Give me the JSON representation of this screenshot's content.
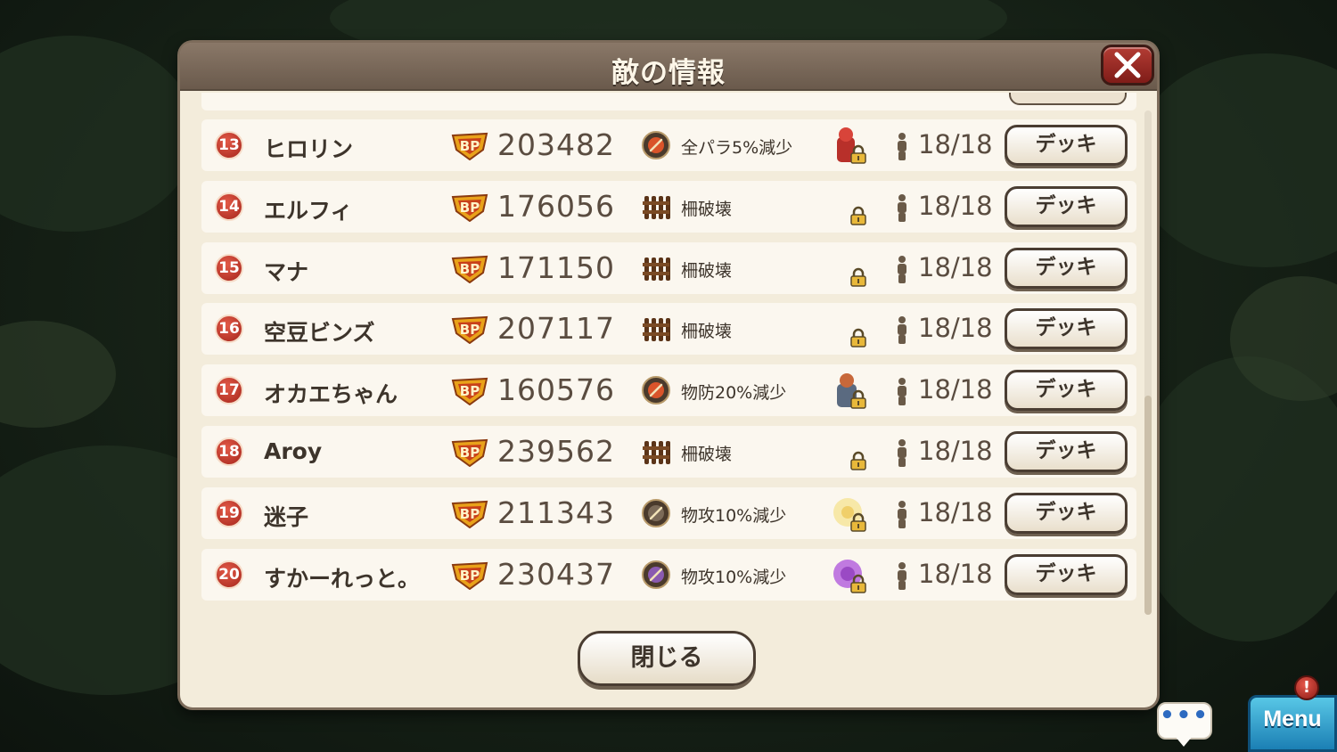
{
  "dialog": {
    "title": "敵の情報",
    "close_icon": "close-x-icon",
    "close_button_label": "閉じる"
  },
  "players": [
    {
      "rank": "13",
      "name": "ヒロリン",
      "bp": "203482",
      "skill_icon": "fire-shield-icon",
      "skill": "全パラ5%減少",
      "pet": "red-knight-pet-icon",
      "stamina": "18/18",
      "deck_label": "デッキ"
    },
    {
      "rank": "14",
      "name": "エルフィ",
      "bp": "176056",
      "skill_icon": "fence-icon",
      "skill": "柵破壊",
      "pet": "none",
      "stamina": "18/18",
      "deck_label": "デッキ"
    },
    {
      "rank": "15",
      "name": "マナ",
      "bp": "171150",
      "skill_icon": "fence-icon",
      "skill": "柵破壊",
      "pet": "none",
      "stamina": "18/18",
      "deck_label": "デッキ"
    },
    {
      "rank": "16",
      "name": "空豆ビンズ",
      "bp": "207117",
      "skill_icon": "fence-icon",
      "skill": "柵破壊",
      "pet": "none",
      "stamina": "18/18",
      "deck_label": "デッキ"
    },
    {
      "rank": "17",
      "name": "オカエちゃん",
      "bp": "160576",
      "skill_icon": "fire-shield-icon",
      "skill": "物防20%減少",
      "pet": "armored-hero-pet-icon",
      "stamina": "18/18",
      "deck_label": "デッキ"
    },
    {
      "rank": "18",
      "name": "Aroy",
      "bp": "239562",
      "skill_icon": "fence-icon",
      "skill": "柵破壊",
      "pet": "none",
      "stamina": "18/18",
      "deck_label": "デッキ"
    },
    {
      "rank": "19",
      "name": "迷子",
      "bp": "211343",
      "skill_icon": "dark-sword-icon",
      "skill": "物攻10%減少",
      "pet": "yellow-flower-pet-icon",
      "stamina": "18/18",
      "deck_label": "デッキ"
    },
    {
      "rank": "20",
      "name": "すかーれっと。",
      "bp": "230437",
      "skill_icon": "purple-sword-icon",
      "skill": "物攻10%減少",
      "pet": "purple-flower-pet-icon",
      "stamina": "18/18",
      "deck_label": "デッキ"
    }
  ],
  "hud": {
    "chat_dots": "•••",
    "menu_label": "Menu",
    "alert_badge": "!"
  },
  "colors": {
    "panel": "#f3ecdb",
    "title_bar": "#7a6a5a",
    "rank_badge": "#c2342a",
    "menu": "#2e9ccf"
  }
}
